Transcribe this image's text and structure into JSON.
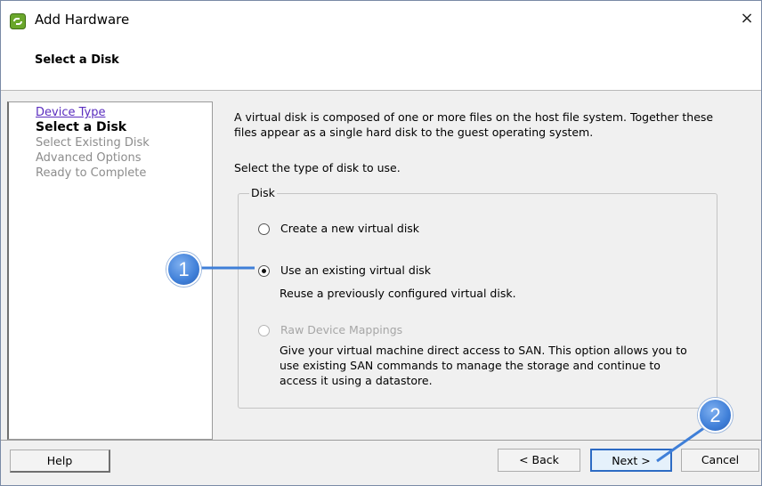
{
  "window": {
    "title": "Add Hardware",
    "close_glyph": "×",
    "app_icon": "vsphere-app-icon"
  },
  "header": {
    "page_title": "Select a Disk"
  },
  "steps": [
    {
      "label": "Device Type",
      "state": "link"
    },
    {
      "label": "Select a Disk",
      "state": "current"
    },
    {
      "label": "Select Existing Disk",
      "state": "pending"
    },
    {
      "label": "Advanced Options",
      "state": "pending"
    },
    {
      "label": "Ready to Complete",
      "state": "pending"
    }
  ],
  "content": {
    "description_line1": "A virtual disk is composed of one or more files on the host file system. Together these",
    "description_line2": "files appear as a single hard disk to the guest operating system.",
    "prompt": "Select the type of disk to use."
  },
  "disk_group": {
    "legend": "Disk",
    "options": [
      {
        "label": "Create a new virtual disk",
        "selected": false,
        "enabled": true
      },
      {
        "label": "Use an existing virtual disk",
        "selected": true,
        "enabled": true,
        "desc": [
          "Reuse a previously configured virtual disk."
        ]
      },
      {
        "label": "Raw Device Mappings",
        "selected": false,
        "enabled": false,
        "desc": [
          "Give your virtual machine direct access to SAN. This option allows you to",
          "use existing SAN commands to manage the storage and continue to",
          "access it using a datastore."
        ]
      }
    ]
  },
  "footer": {
    "help_label": "Help",
    "back_label": "< Back",
    "next_label": "Next >",
    "cancel_label": "Cancel"
  },
  "callouts": [
    {
      "label": "1"
    },
    {
      "label": "2"
    }
  ],
  "colors": {
    "callout_blue": "#3f7fd8",
    "link_purple": "#5a2dbf",
    "disabled_text": "#a6a6a6",
    "next_border": "#2d6bc4"
  }
}
